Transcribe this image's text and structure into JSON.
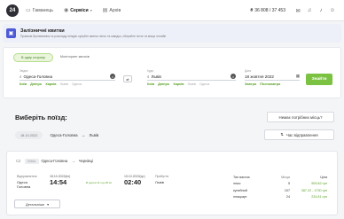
{
  "app": {
    "logo": "24"
  },
  "nav": [
    {
      "label": "Гаманець",
      "icon": "wallet-icon",
      "glyph": "▭",
      "active": false,
      "has_menu": false
    },
    {
      "label": "Сервіси",
      "icon": "services-icon",
      "glyph": "◉",
      "active": true,
      "has_menu": true
    },
    {
      "label": "Архів",
      "icon": "archive-icon",
      "glyph": "▤",
      "active": false,
      "has_menu": false
    }
  ],
  "balance": "36 808 / 37 453",
  "currency_glyph": "₴",
  "banner": {
    "title": "Залізничні квитки",
    "subtitle": "Правила бронювання та розкладу поїздів: купуйте квитки легко та швидко, обирайте потяг та місце онлайн"
  },
  "search": {
    "tabs": [
      "В одну сторону",
      "Моніторинг квитків"
    ],
    "from_label": "Звідки",
    "from_value": "Одеса-Головна",
    "from_quick": [
      "Київ",
      "Дніпро",
      "Харків"
    ],
    "from_quick_gray": [
      "Львів",
      "Одеса"
    ],
    "to_label": "Куди",
    "to_value": "Львів",
    "to_quick": [
      "Київ",
      "Дніпро",
      "Харків"
    ],
    "to_quick_gray": [
      "Львів",
      "Одеса"
    ],
    "date_label": "Дата",
    "date_value": "18 жовтня 2022",
    "date_quick": [
      "Завтра",
      "Післязавтра"
    ],
    "find_label": "Знайти"
  },
  "results": {
    "title": "Виберіть поїзд:",
    "no_seat_label": "Немає потрібних місць?",
    "date_pill": "18.10.2022",
    "route_from": "Одеса-Головна",
    "route_to": "Львів",
    "sort_label": "Час відправлення"
  },
  "train": {
    "number": "006Ш",
    "route_from": "Одеса-Головна",
    "route_to": "Чернівці",
    "departure_label": "Відправлення",
    "departure_station": "Одеса Головна",
    "departure_date": "18.10.2022(вт)",
    "departure_time": "14:54",
    "duration": "В дорозі 11 год 48 хв",
    "arrival_date": "19.10.2022(ср)",
    "arrival_time": "02:40",
    "arrival_label": "Прибуття",
    "arrival_station": "Львів",
    "seat_header_type": "Тип вагона",
    "seat_header_count": "Місця",
    "seat_header_price": "Ціна",
    "seats": [
      {
        "type": "люкс",
        "count": "5",
        "price": "905.82 грн"
      },
      {
        "type": "купейний",
        "count": "107",
        "price": "387.22 - 1730 грн"
      },
      {
        "type": "плацкарт",
        "count": "24",
        "price": "234.81 грн"
      }
    ],
    "details_label": "Детальніше"
  }
}
